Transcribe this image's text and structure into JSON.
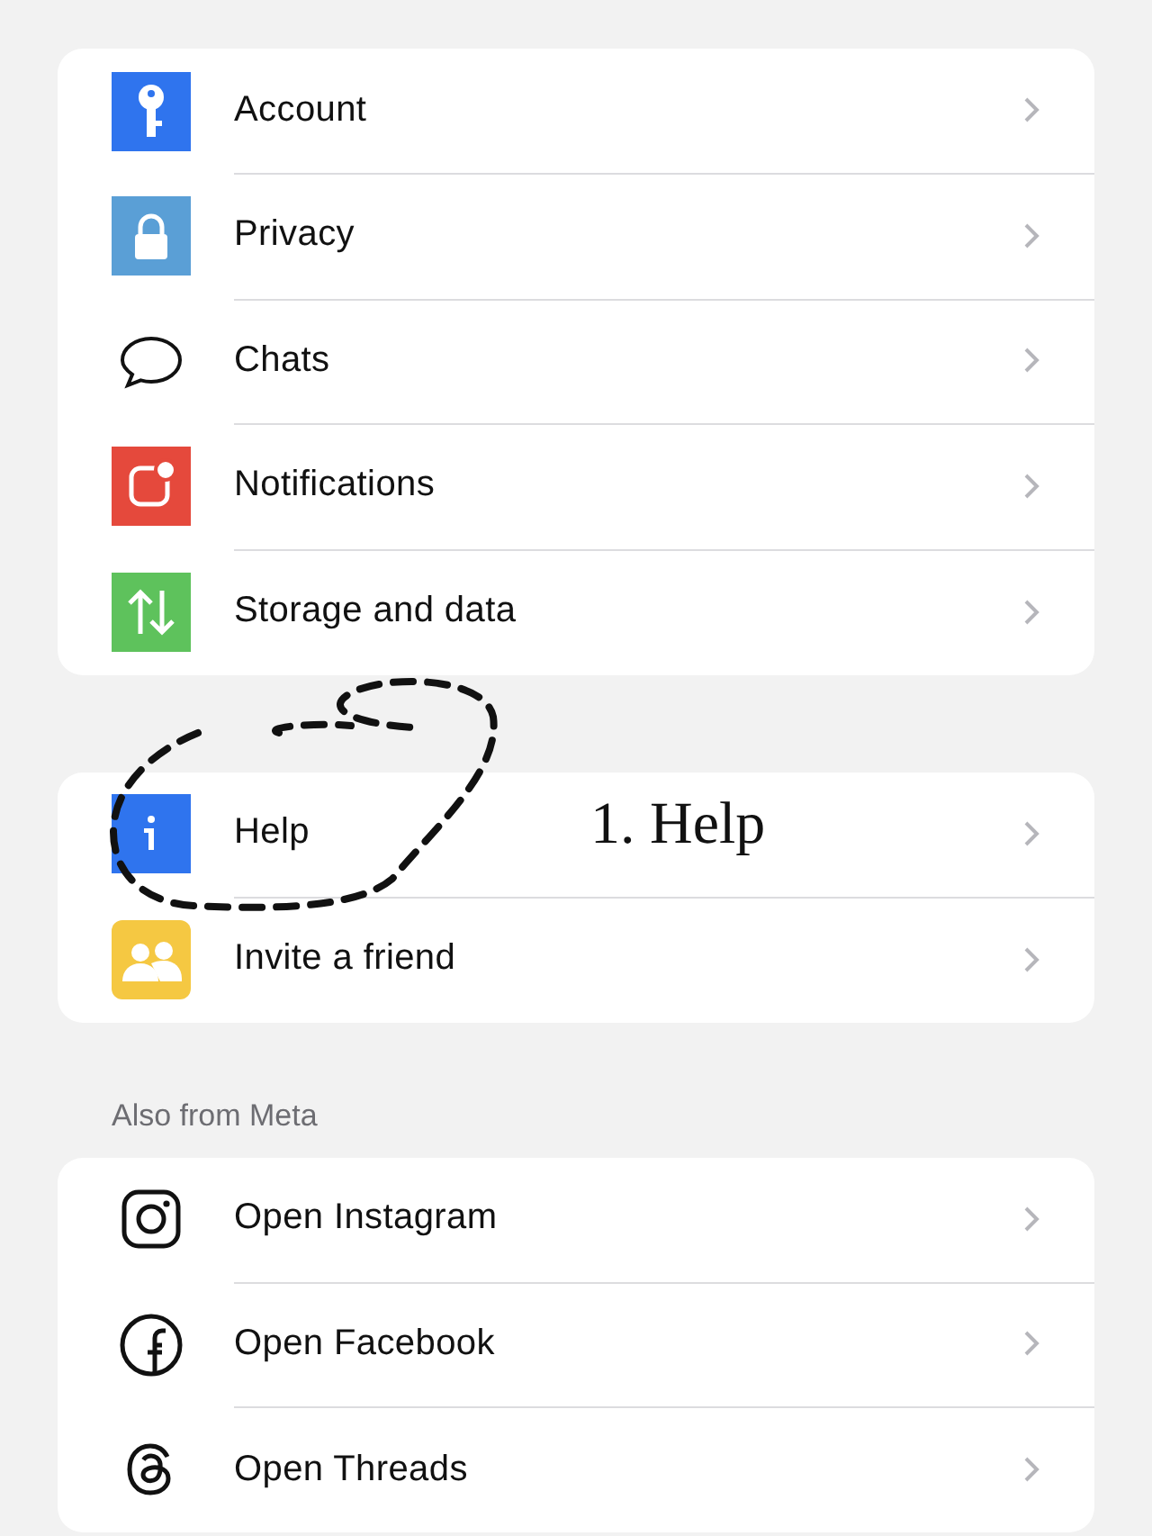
{
  "sections": [
    {
      "items": [
        {
          "label": "Account"
        },
        {
          "label": "Privacy"
        },
        {
          "label": "Chats"
        },
        {
          "label": "Notifications"
        },
        {
          "label": "Storage and data"
        }
      ]
    },
    {
      "items": [
        {
          "label": "Help"
        },
        {
          "label": "Invite a friend"
        }
      ]
    },
    {
      "header": "Also from Meta",
      "items": [
        {
          "label": "Open Instagram"
        },
        {
          "label": "Open Facebook"
        },
        {
          "label": "Open Threads"
        }
      ]
    }
  ],
  "annotation": {
    "label": "1. Help"
  }
}
